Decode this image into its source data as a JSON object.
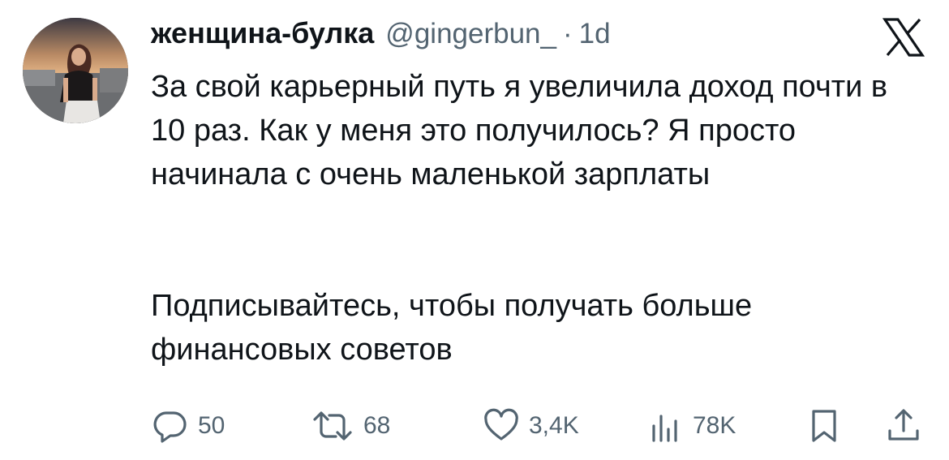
{
  "author": {
    "display_name": "женщина-булка",
    "handle": "@gingerbun_",
    "separator": "·",
    "time": "1d"
  },
  "platform": {
    "logo_icon": "x-logo-icon"
  },
  "tweet": {
    "paragraph_1": "За свой карьерный путь я увеличила доход почти в 10 раз. Как у меня это получилось? Я просто начинала с очень маленькой зарплаты",
    "paragraph_2": "Подписывайтесь, чтобы получать больше финансовых советов"
  },
  "actions": {
    "replies": {
      "icon": "reply-icon",
      "count": "50"
    },
    "reposts": {
      "icon": "repost-icon",
      "count": "68"
    },
    "likes": {
      "icon": "heart-icon",
      "count": "3,4K"
    },
    "views": {
      "icon": "views-icon",
      "count": "78K"
    },
    "bookmark": {
      "icon": "bookmark-icon"
    },
    "share": {
      "icon": "share-icon"
    }
  },
  "colors": {
    "text_primary": "#0f1419",
    "text_secondary": "#536471",
    "background": "#ffffff"
  }
}
